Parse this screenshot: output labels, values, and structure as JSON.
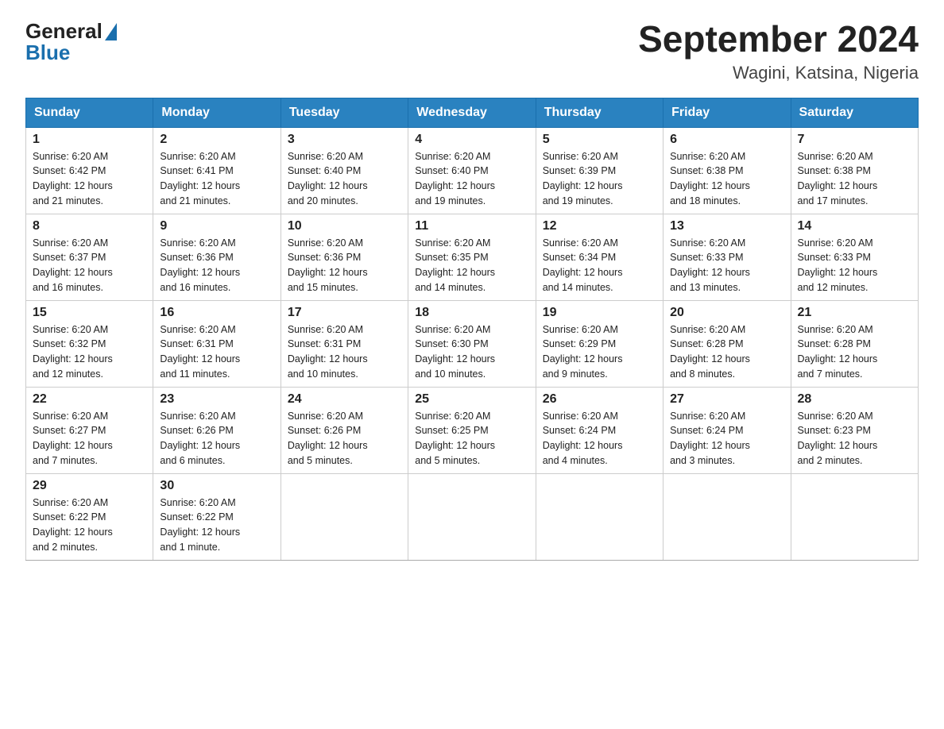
{
  "header": {
    "title": "September 2024",
    "subtitle": "Wagini, Katsina, Nigeria"
  },
  "logo": {
    "general": "General",
    "blue": "Blue"
  },
  "days": [
    "Sunday",
    "Monday",
    "Tuesday",
    "Wednesday",
    "Thursday",
    "Friday",
    "Saturday"
  ],
  "weeks": [
    [
      {
        "date": "1",
        "sunrise": "6:20 AM",
        "sunset": "6:42 PM",
        "daylight": "12 hours and 21 minutes."
      },
      {
        "date": "2",
        "sunrise": "6:20 AM",
        "sunset": "6:41 PM",
        "daylight": "12 hours and 21 minutes."
      },
      {
        "date": "3",
        "sunrise": "6:20 AM",
        "sunset": "6:40 PM",
        "daylight": "12 hours and 20 minutes."
      },
      {
        "date": "4",
        "sunrise": "6:20 AM",
        "sunset": "6:40 PM",
        "daylight": "12 hours and 19 minutes."
      },
      {
        "date": "5",
        "sunrise": "6:20 AM",
        "sunset": "6:39 PM",
        "daylight": "12 hours and 19 minutes."
      },
      {
        "date": "6",
        "sunrise": "6:20 AM",
        "sunset": "6:38 PM",
        "daylight": "12 hours and 18 minutes."
      },
      {
        "date": "7",
        "sunrise": "6:20 AM",
        "sunset": "6:38 PM",
        "daylight": "12 hours and 17 minutes."
      }
    ],
    [
      {
        "date": "8",
        "sunrise": "6:20 AM",
        "sunset": "6:37 PM",
        "daylight": "12 hours and 16 minutes."
      },
      {
        "date": "9",
        "sunrise": "6:20 AM",
        "sunset": "6:36 PM",
        "daylight": "12 hours and 16 minutes."
      },
      {
        "date": "10",
        "sunrise": "6:20 AM",
        "sunset": "6:36 PM",
        "daylight": "12 hours and 15 minutes."
      },
      {
        "date": "11",
        "sunrise": "6:20 AM",
        "sunset": "6:35 PM",
        "daylight": "12 hours and 14 minutes."
      },
      {
        "date": "12",
        "sunrise": "6:20 AM",
        "sunset": "6:34 PM",
        "daylight": "12 hours and 14 minutes."
      },
      {
        "date": "13",
        "sunrise": "6:20 AM",
        "sunset": "6:33 PM",
        "daylight": "12 hours and 13 minutes."
      },
      {
        "date": "14",
        "sunrise": "6:20 AM",
        "sunset": "6:33 PM",
        "daylight": "12 hours and 12 minutes."
      }
    ],
    [
      {
        "date": "15",
        "sunrise": "6:20 AM",
        "sunset": "6:32 PM",
        "daylight": "12 hours and 12 minutes."
      },
      {
        "date": "16",
        "sunrise": "6:20 AM",
        "sunset": "6:31 PM",
        "daylight": "12 hours and 11 minutes."
      },
      {
        "date": "17",
        "sunrise": "6:20 AM",
        "sunset": "6:31 PM",
        "daylight": "12 hours and 10 minutes."
      },
      {
        "date": "18",
        "sunrise": "6:20 AM",
        "sunset": "6:30 PM",
        "daylight": "12 hours and 10 minutes."
      },
      {
        "date": "19",
        "sunrise": "6:20 AM",
        "sunset": "6:29 PM",
        "daylight": "12 hours and 9 minutes."
      },
      {
        "date": "20",
        "sunrise": "6:20 AM",
        "sunset": "6:28 PM",
        "daylight": "12 hours and 8 minutes."
      },
      {
        "date": "21",
        "sunrise": "6:20 AM",
        "sunset": "6:28 PM",
        "daylight": "12 hours and 7 minutes."
      }
    ],
    [
      {
        "date": "22",
        "sunrise": "6:20 AM",
        "sunset": "6:27 PM",
        "daylight": "12 hours and 7 minutes."
      },
      {
        "date": "23",
        "sunrise": "6:20 AM",
        "sunset": "6:26 PM",
        "daylight": "12 hours and 6 minutes."
      },
      {
        "date": "24",
        "sunrise": "6:20 AM",
        "sunset": "6:26 PM",
        "daylight": "12 hours and 5 minutes."
      },
      {
        "date": "25",
        "sunrise": "6:20 AM",
        "sunset": "6:25 PM",
        "daylight": "12 hours and 5 minutes."
      },
      {
        "date": "26",
        "sunrise": "6:20 AM",
        "sunset": "6:24 PM",
        "daylight": "12 hours and 4 minutes."
      },
      {
        "date": "27",
        "sunrise": "6:20 AM",
        "sunset": "6:24 PM",
        "daylight": "12 hours and 3 minutes."
      },
      {
        "date": "28",
        "sunrise": "6:20 AM",
        "sunset": "6:23 PM",
        "daylight": "12 hours and 2 minutes."
      }
    ],
    [
      {
        "date": "29",
        "sunrise": "6:20 AM",
        "sunset": "6:22 PM",
        "daylight": "12 hours and 2 minutes."
      },
      {
        "date": "30",
        "sunrise": "6:20 AM",
        "sunset": "6:22 PM",
        "daylight": "12 hours and 1 minute."
      },
      null,
      null,
      null,
      null,
      null
    ]
  ],
  "labels": {
    "sunrise": "Sunrise:",
    "sunset": "Sunset:",
    "daylight": "Daylight:"
  }
}
